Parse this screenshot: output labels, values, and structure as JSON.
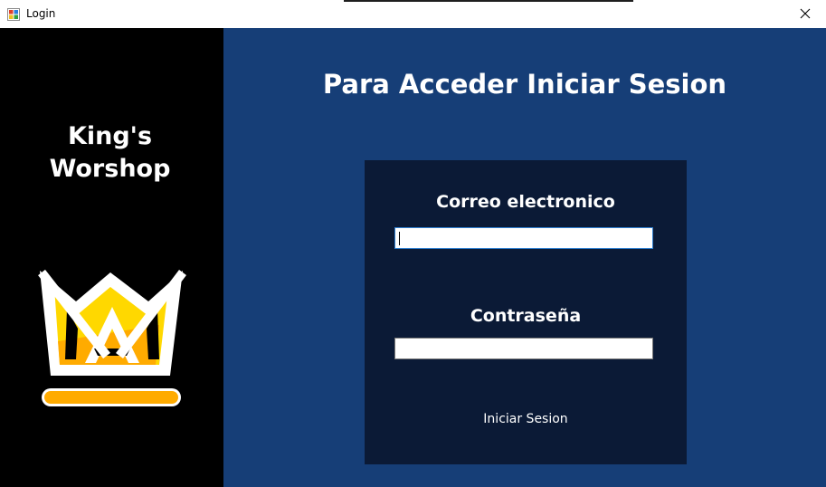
{
  "window": {
    "title": "Login",
    "icon": "app-window-icon",
    "close_icon": "close-icon"
  },
  "brand": {
    "name": "King's\nWorshop",
    "logo_icon": "crown-logo-icon"
  },
  "main": {
    "heading": "Para Acceder Iniciar Sesion"
  },
  "login_form": {
    "email_label": "Correo electronico",
    "email_value": "",
    "password_label": "Contraseña",
    "password_value": "",
    "submit_label": "Iniciar Sesion"
  },
  "colors": {
    "left_panel": "#000000",
    "right_panel": "#163e77",
    "form_box": "#0b1a36",
    "logo_yellow": "#ffd800",
    "logo_orange": "#ffab00"
  }
}
